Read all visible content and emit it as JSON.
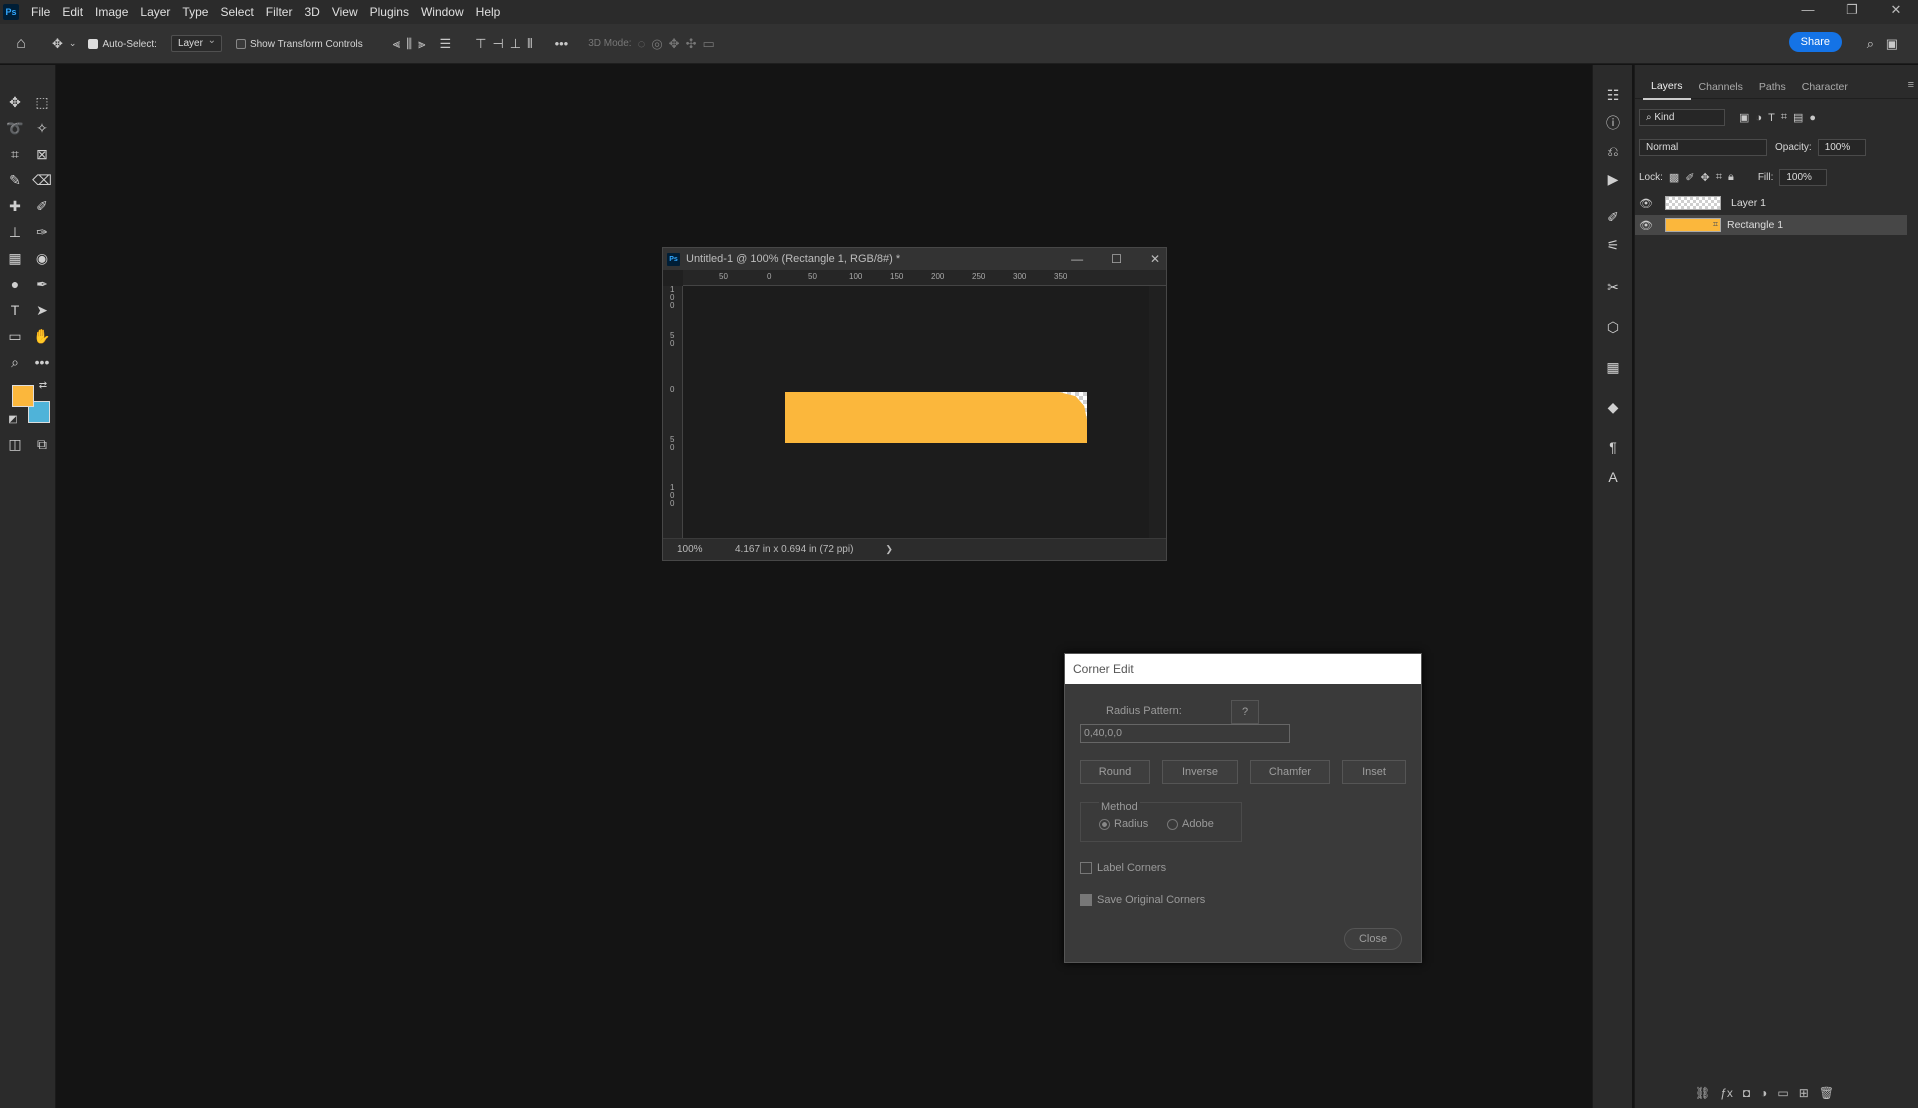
{
  "app": {
    "logo": "Ps"
  },
  "menu": [
    "File",
    "Edit",
    "Image",
    "Layer",
    "Type",
    "Select",
    "Filter",
    "3D",
    "View",
    "Plugins",
    "Window",
    "Help"
  ],
  "window_controls": {
    "minimize": "—",
    "restore": "❐",
    "close": "✕"
  },
  "options_bar": {
    "auto_select_label": "Auto-Select:",
    "auto_select_value": "Layer",
    "show_transform_label": "Show Transform Controls",
    "mode_3d_label": "3D Mode:",
    "share_label": "Share"
  },
  "colors": {
    "foreground": "#fbb73c",
    "background": "#4fb3d9",
    "accent": "#1473e6"
  },
  "layers_panel": {
    "tabs": [
      "Layers",
      "Channels",
      "Paths",
      "Character"
    ],
    "filter_kind": "Kind",
    "blend_mode": "Normal",
    "opacity_label": "Opacity:",
    "opacity_value": "100%",
    "lock_label": "Lock:",
    "fill_label": "Fill:",
    "fill_value": "100%",
    "layers": [
      {
        "name": "Layer 1",
        "thumb": "transparent",
        "selected": false
      },
      {
        "name": "Rectangle 1",
        "thumb": "#fbb73c",
        "selected": true
      }
    ]
  },
  "document": {
    "title": "Untitled-1 @ 100% (Rectangle 1, RGB/8#) *",
    "ruler_h": [
      "50",
      "0",
      "50",
      "100",
      "150",
      "200",
      "250",
      "300",
      "350"
    ],
    "ruler_v": [
      "1\n0\n0",
      "5\n0",
      "0",
      "5\n0",
      "1\n0\n0"
    ],
    "zoom": "100%",
    "doc_info": "4.167 in x 0.694 in (72 ppi)",
    "status_arrow": "❯"
  },
  "dialog": {
    "title": "Corner Edit",
    "radius_pattern_label": "Radius Pattern:",
    "help_label": "?",
    "radius_pattern_value": "0,40,0,0",
    "buttons": [
      "Round",
      "Inverse",
      "Chamfer",
      "Inset"
    ],
    "method_label": "Method",
    "method_radius": "Radius",
    "method_adobe": "Adobe",
    "label_corners": "Label Corners",
    "save_original": "Save Original Corners",
    "close_label": "Close"
  }
}
